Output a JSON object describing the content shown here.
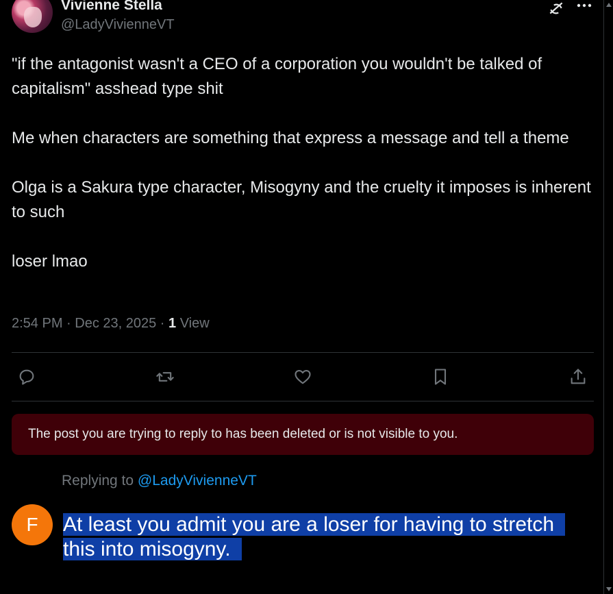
{
  "post": {
    "display_name": "Vivienne Stella",
    "handle": "@LadyVivienneVT",
    "paragraphs": [
      "\"if the antagonist wasn't a CEO of a corporation you wouldn't be talked of capitalism\" asshead type shit",
      "Me when characters are something that express a message and tell a theme",
      "Olga is a Sakura type character, Misogyny and the cruelty it imposes is inherent to such",
      "loser lmao"
    ],
    "time": "2:54 PM · Dec 23, 2025 · ",
    "view_count": "1",
    "view_label": " View"
  },
  "header_icons": [
    "grok-icon",
    "more-icon"
  ],
  "actions": [
    "reply-icon",
    "repost-icon",
    "like-icon",
    "bookmark-icon",
    "share-icon"
  ],
  "notice": {
    "deleted_text": "The post you are trying to reply to has been deleted or is not visible to you.",
    "background": "#3f0008"
  },
  "reply": {
    "replying_prefix": "Replying to ",
    "replying_handle": "@LadyVivienneVT",
    "avatar_letter": "F",
    "avatar_color": "#f4760a",
    "text": "At least you admit you are a loser for having to stretch this into misogyny."
  },
  "colors": {
    "accent": "#1d9bf0",
    "muted": "#71767b",
    "selection": "#0f3fa6"
  }
}
